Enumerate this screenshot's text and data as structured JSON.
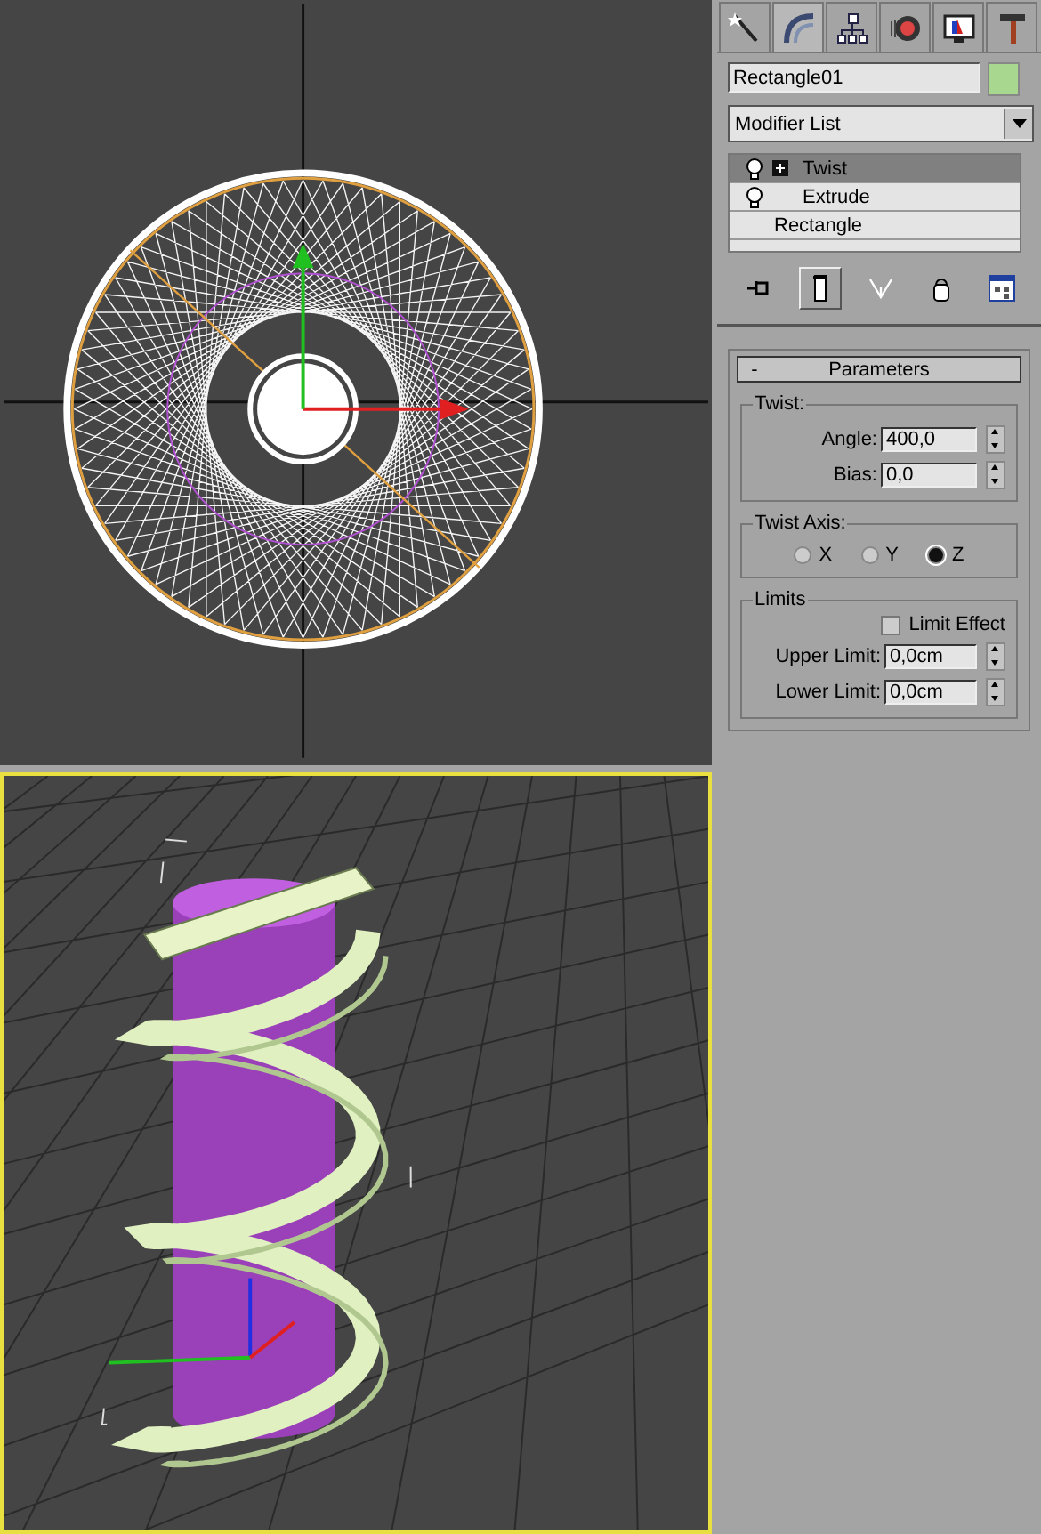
{
  "viewports": [
    {
      "kind": "top",
      "active": false
    },
    {
      "kind": "perspective",
      "active": true
    }
  ],
  "panel_tabs": [
    {
      "kind": "create",
      "selected": false
    },
    {
      "kind": "modify",
      "selected": true
    },
    {
      "kind": "hierarchy",
      "selected": false
    },
    {
      "kind": "motion",
      "selected": false
    },
    {
      "kind": "display",
      "selected": false
    },
    {
      "kind": "utilities",
      "selected": false
    }
  ],
  "object_name": "Rectangle01",
  "modifier_list": "Modifier List",
  "modifier_stack": [
    {
      "label": "Twist",
      "kind": "modifier",
      "selected": true
    },
    {
      "label": "Extrude",
      "kind": "modifier",
      "selected": false
    },
    {
      "label": "Rectangle",
      "kind": "base",
      "selected": false
    }
  ],
  "stack_tools": [
    {
      "kind": "pin",
      "selected": false
    },
    {
      "kind": "show-end",
      "selected": true
    },
    {
      "kind": "unique",
      "selected": false
    },
    {
      "kind": "remove",
      "selected": false
    },
    {
      "kind": "configure",
      "selected": false
    }
  ],
  "rollout": {
    "collapse": "-",
    "title": "Parameters"
  },
  "twist": {
    "title": "Twist:",
    "fields": [
      {
        "label": "Angle:",
        "value": "400,0"
      },
      {
        "label": "Bias:",
        "value": "0,0"
      }
    ]
  },
  "twist_axis": {
    "title": "Twist Axis:",
    "options": [
      {
        "label": "X",
        "selected": false
      },
      {
        "label": "Y",
        "selected": false
      },
      {
        "label": "Z",
        "selected": true
      }
    ]
  },
  "limits": {
    "title": "Limits",
    "limit_effect": {
      "label": "Limit Effect",
      "checked": false
    },
    "fields": [
      {
        "label": "Upper Limit:",
        "value": "0,0cm"
      },
      {
        "label": "Lower Limit:",
        "value": "0,0cm"
      }
    ]
  }
}
